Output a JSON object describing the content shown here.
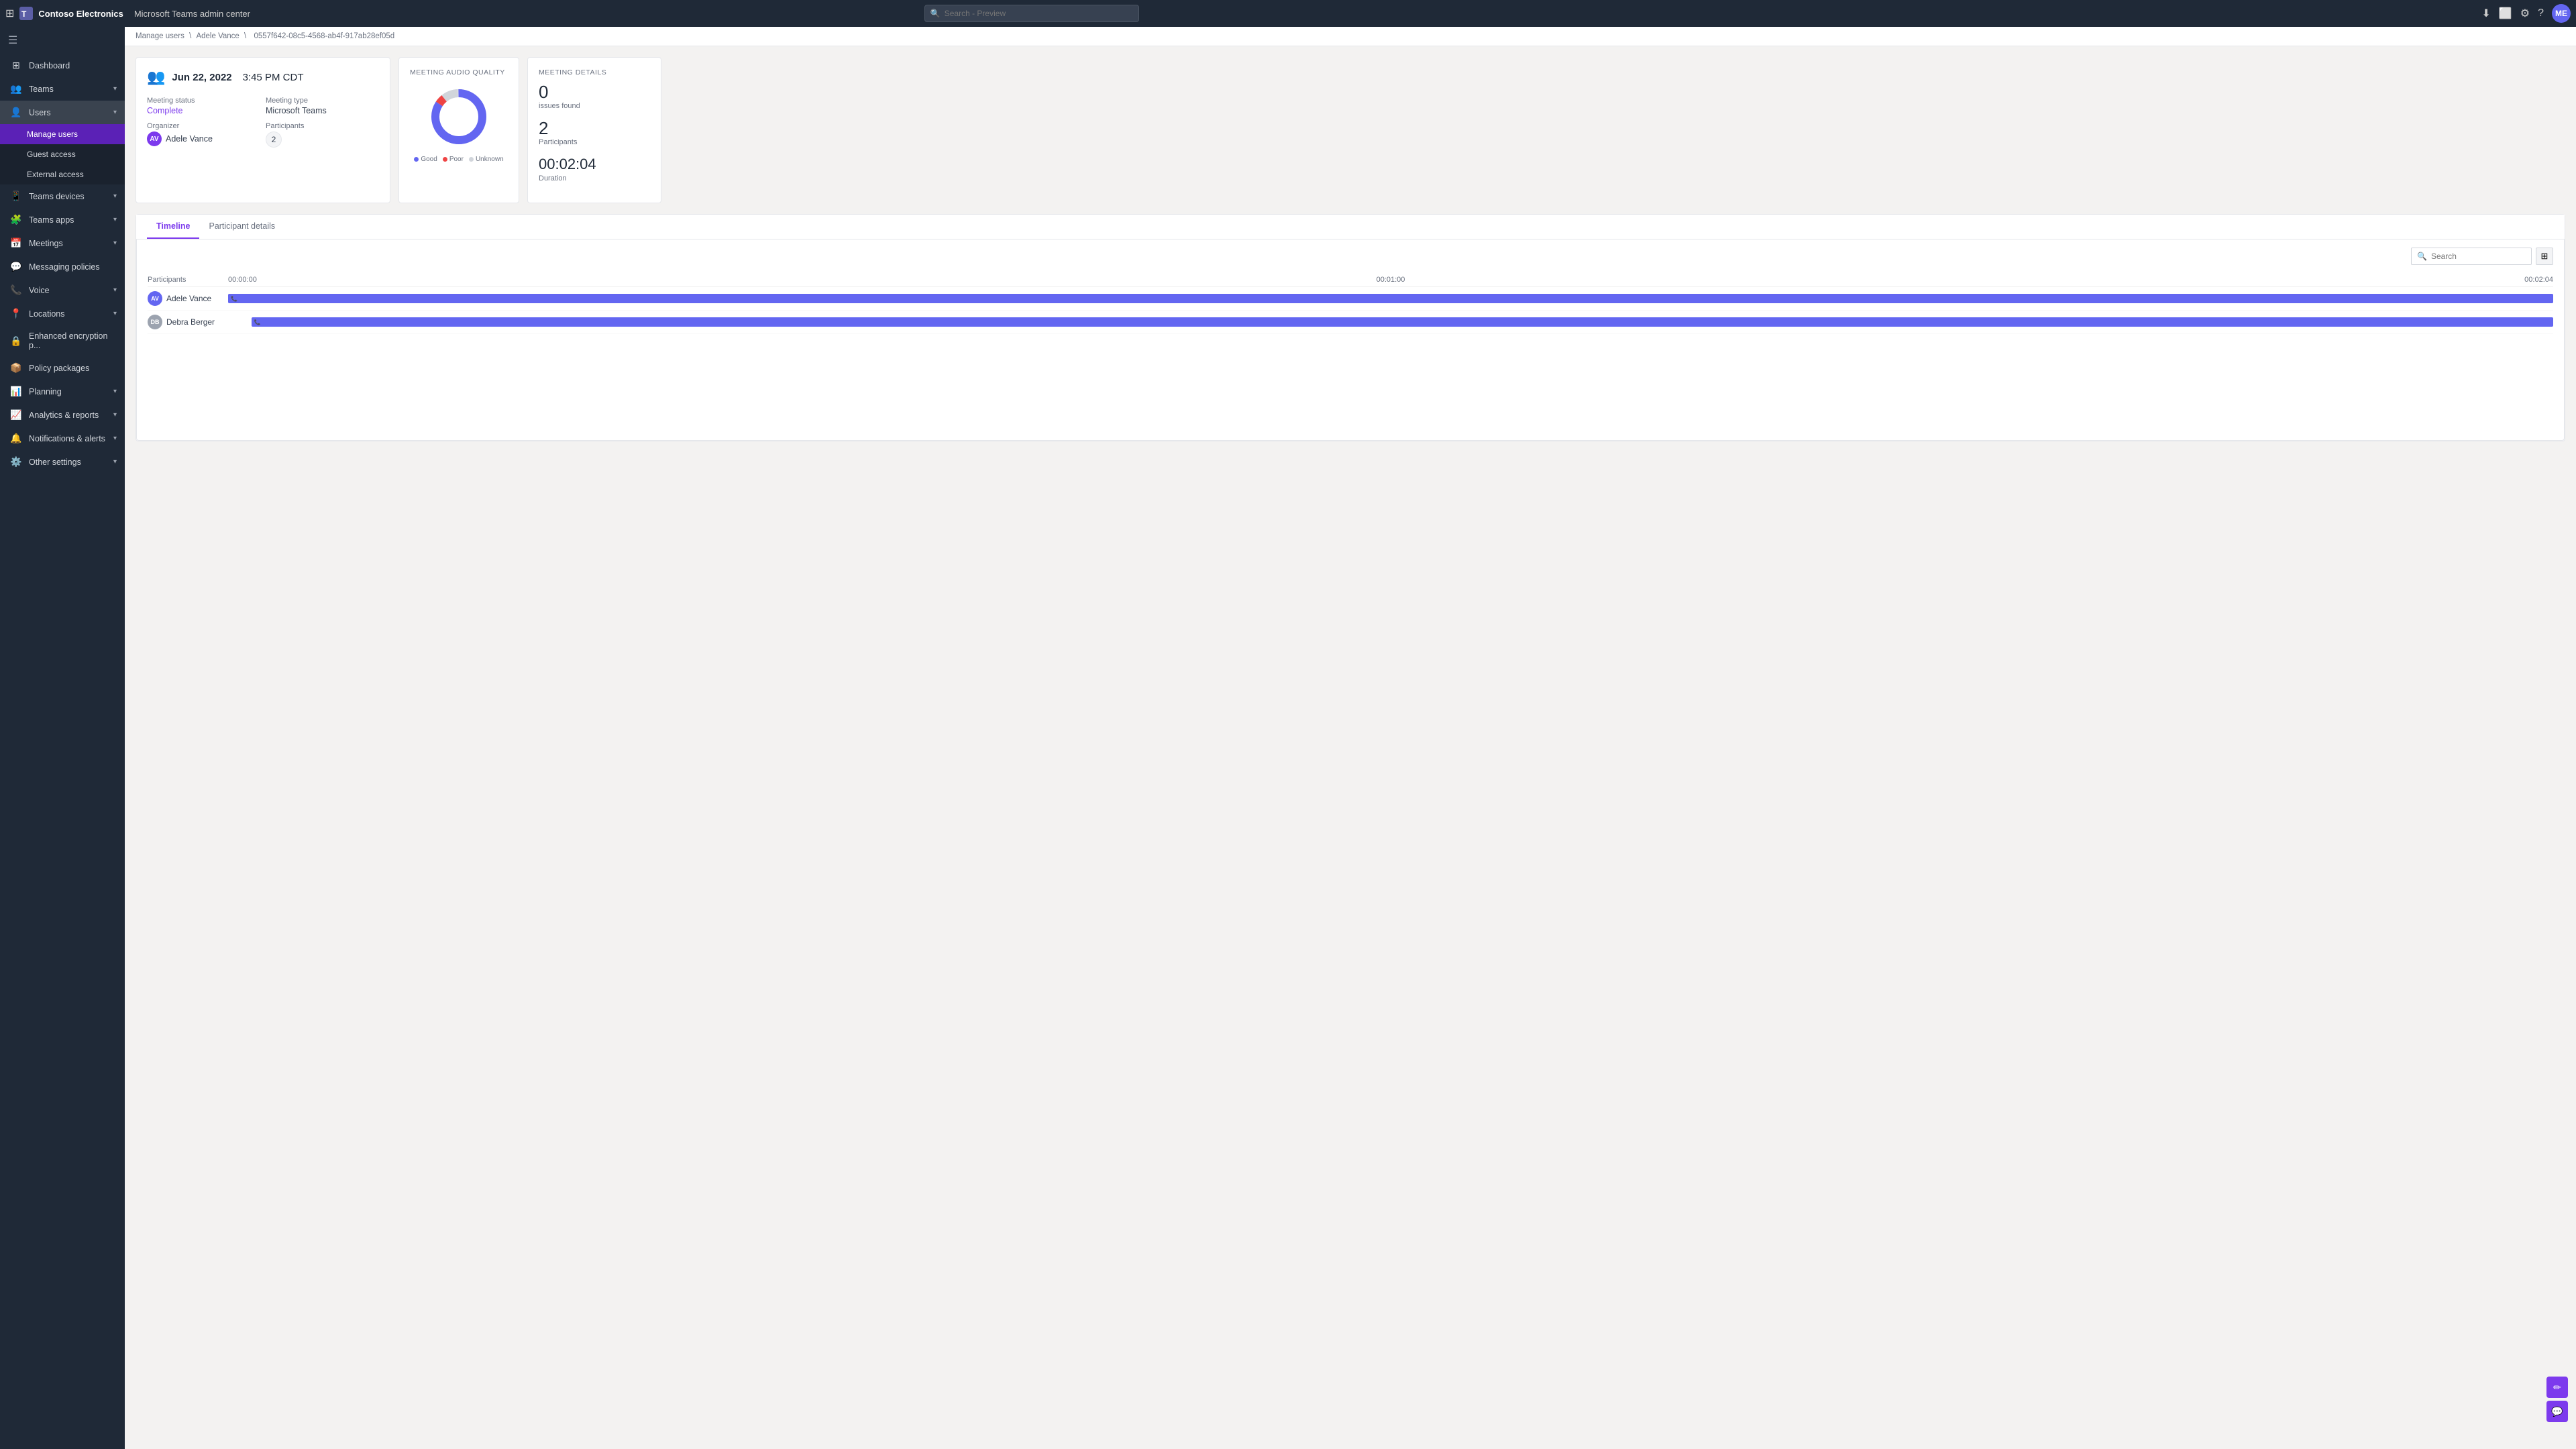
{
  "app": {
    "company": "Contoso Electronics",
    "product": "Microsoft Teams admin center",
    "waffle": "⊞",
    "avatar_initials": "ME"
  },
  "topbar": {
    "search_placeholder": "Search - Preview",
    "icons": [
      "download",
      "browser",
      "settings",
      "help"
    ]
  },
  "breadcrumb": {
    "parts": [
      "Manage users",
      "Adele Vance",
      "0557f642-08c5-4568-ab4f-917ab28ef05d"
    ]
  },
  "sidebar": {
    "hamburger": "☰",
    "items": [
      {
        "id": "dashboard",
        "label": "Dashboard",
        "icon": "⊞",
        "expandable": false
      },
      {
        "id": "teams",
        "label": "Teams",
        "icon": "👥",
        "expandable": true
      },
      {
        "id": "users",
        "label": "Users",
        "icon": "👤",
        "expandable": true,
        "expanded": true
      },
      {
        "id": "manage-users",
        "label": "Manage users",
        "icon": "",
        "sub": true,
        "active": true
      },
      {
        "id": "guest-access",
        "label": "Guest access",
        "icon": "",
        "sub": true
      },
      {
        "id": "external-access",
        "label": "External access",
        "icon": "",
        "sub": true
      },
      {
        "id": "teams-devices",
        "label": "Teams devices",
        "icon": "📱",
        "expandable": true
      },
      {
        "id": "teams-apps",
        "label": "Teams apps",
        "icon": "🧩",
        "expandable": true
      },
      {
        "id": "meetings",
        "label": "Meetings",
        "icon": "📅",
        "expandable": true
      },
      {
        "id": "messaging-policies",
        "label": "Messaging policies",
        "icon": "💬",
        "expandable": false
      },
      {
        "id": "voice",
        "label": "Voice",
        "icon": "📞",
        "expandable": true
      },
      {
        "id": "locations",
        "label": "Locations",
        "icon": "📍",
        "expandable": true
      },
      {
        "id": "enhanced-encryption",
        "label": "Enhanced encryption p...",
        "icon": "🔒",
        "expandable": false
      },
      {
        "id": "policy-packages",
        "label": "Policy packages",
        "icon": "📦",
        "expandable": false
      },
      {
        "id": "planning",
        "label": "Planning",
        "icon": "📊",
        "expandable": true
      },
      {
        "id": "analytics-reports",
        "label": "Analytics & reports",
        "icon": "📈",
        "expandable": true
      },
      {
        "id": "notifications-alerts",
        "label": "Notifications & alerts",
        "icon": "🔔",
        "expandable": true
      },
      {
        "id": "other-settings",
        "label": "Other settings",
        "icon": "⚙️",
        "expandable": true
      }
    ]
  },
  "meeting": {
    "date": "Jun 22, 2022",
    "time": "3:45 PM CDT",
    "icon": "👥",
    "status_label": "Meeting status",
    "status_value": "Complete",
    "type_label": "Meeting type",
    "type_value": "Microsoft Teams",
    "organizer_label": "Organizer",
    "organizer_name": "Adele Vance",
    "organizer_initials": "AV",
    "participants_label": "Participants",
    "participants_count": "2"
  },
  "audio_quality": {
    "title": "MEETING AUDIO QUALITY",
    "legend": [
      {
        "label": "Good",
        "color": "#6366f1"
      },
      {
        "label": "Poor",
        "color": "#ef4444"
      },
      {
        "label": "Unknown",
        "color": "#d1d5db"
      }
    ],
    "donut": {
      "good_pct": 85,
      "poor_pct": 5,
      "unknown_pct": 10
    }
  },
  "meeting_details": {
    "title": "MEETING DETAILS",
    "issues_count": "0",
    "issues_label": "issues found",
    "participants_count": "2",
    "participants_label": "Participants",
    "duration": "00:02:04",
    "duration_label": "Duration"
  },
  "tabs": {
    "items": [
      {
        "id": "timeline",
        "label": "Timeline",
        "active": true
      },
      {
        "id": "participant-details",
        "label": "Participant details",
        "active": false
      }
    ]
  },
  "timeline": {
    "search_placeholder": "Search",
    "col_participants": "Participants",
    "col_start": "00:00:00",
    "col_mid": "00:01:00",
    "col_end": "00:02:04",
    "participants": [
      {
        "name": "Adele Vance",
        "initials": "AV",
        "bar_left": "0%",
        "bar_width": "100%"
      },
      {
        "name": "Debra Berger",
        "initials": "DB",
        "bar_left": "1%",
        "bar_width": "99%"
      }
    ]
  }
}
